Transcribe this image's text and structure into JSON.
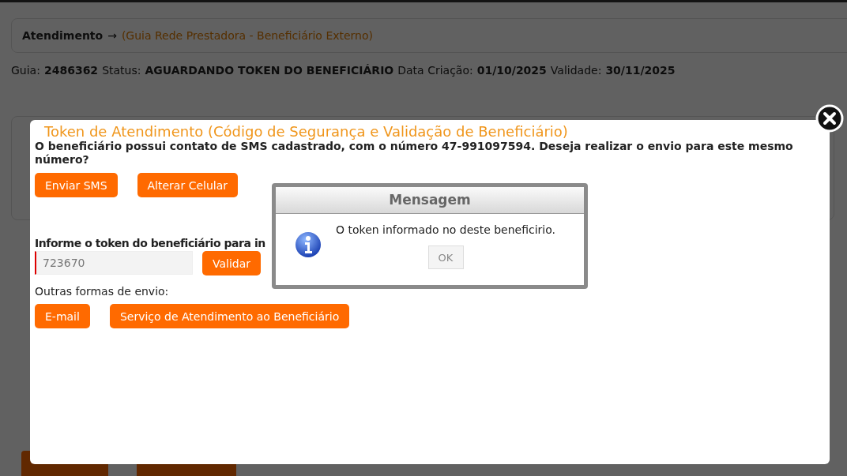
{
  "page": {
    "breadcrumb": {
      "section": "Atendimento",
      "arrow": "→",
      "path": "(Guia Rede Prestadora - Beneficiário Externo)"
    },
    "info": [
      {
        "label": "Guia:",
        "value": "2486362"
      },
      {
        "label": "Status:",
        "value": "AGUARDANDO TOKEN DO BENEFICIÁRIO"
      },
      {
        "label": "Data Criação:",
        "value": "01/10/2025"
      },
      {
        "label": "Validade:",
        "value": "30/11/2025"
      }
    ]
  },
  "token_dialog": {
    "title": "Token de Atendimento (Código de Segurança e Validação de Beneficiário)",
    "question": "O beneficiário possui contato de SMS cadastrado, com o número 47-991097594. Deseja realizar o envio para este mesmo número?",
    "sms_buttons": [
      "Enviar SMS",
      "Alterar Celular"
    ],
    "token_label": "Informe o token do beneficiário para in",
    "token_field": {
      "value": "723670",
      "invalid": true
    },
    "validate_button": "Validar",
    "other_label": "Outras formas de envio:",
    "other_buttons": [
      "E-mail",
      "Serviço de Atendimento ao Beneficiário"
    ]
  },
  "message_box": {
    "title": "Mensagem",
    "text": "O token informado no deste beneficirio.",
    "button": "OK"
  }
}
